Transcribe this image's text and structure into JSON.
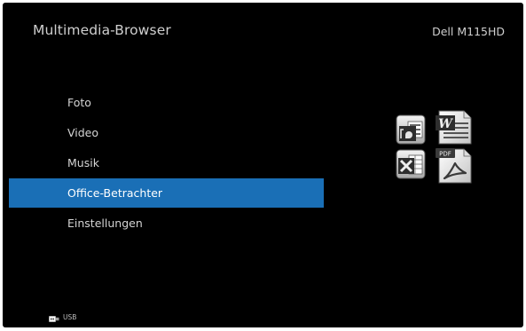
{
  "header": {
    "title": "Multimedia-Browser",
    "device": "Dell M115HD"
  },
  "menu": {
    "items": [
      {
        "label": "Foto"
      },
      {
        "label": "Video"
      },
      {
        "label": "Musik"
      },
      {
        "label": "Office-Betrachter",
        "selected": true
      },
      {
        "label": "Einstellungen"
      }
    ],
    "selected_color": "#1a6fb6"
  },
  "preview": {
    "icons": [
      "presentation-icon",
      "word-document-icon",
      "excel-spreadsheet-icon",
      "pdf-icon"
    ],
    "pdf_badge": "PDF"
  },
  "status": {
    "source_icon": "usb-icon",
    "source_label": "USB"
  }
}
